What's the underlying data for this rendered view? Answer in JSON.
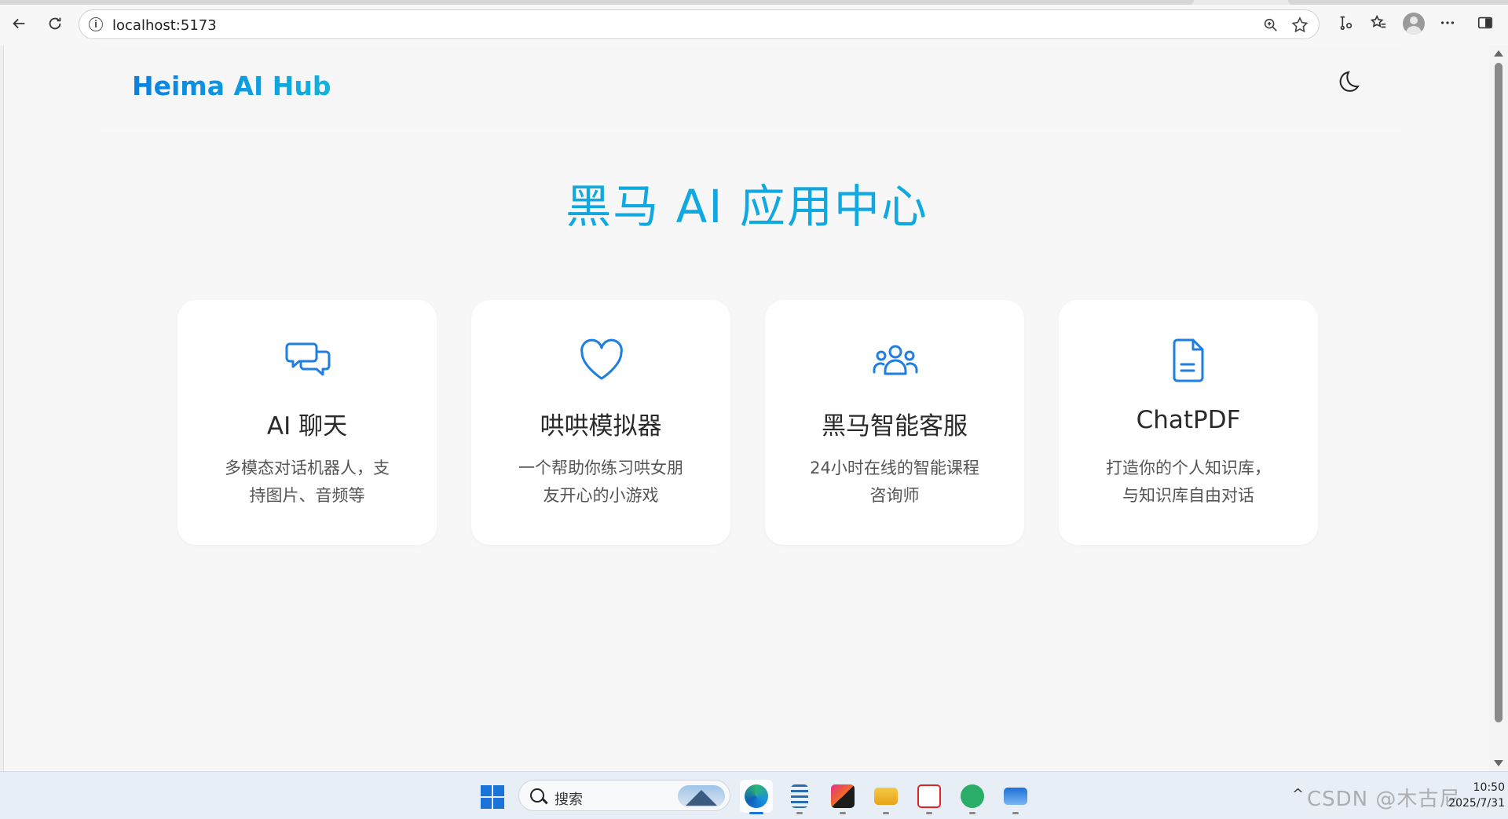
{
  "browser": {
    "url": "localhost:5173"
  },
  "app": {
    "logo": "Heima AI Hub",
    "page_title": "黑马 AI 应用中心"
  },
  "cards": [
    {
      "icon": "chat-bubbles-icon",
      "title": "AI 聊天",
      "desc": "多模态对话机器人，支持图片、音频等"
    },
    {
      "icon": "heart-icon",
      "title": "哄哄模拟器",
      "desc": "一个帮助你练习哄女朋友开心的小游戏"
    },
    {
      "icon": "group-icon",
      "title": "黑马智能客服",
      "desc": "24小时在线的智能课程咨询师"
    },
    {
      "icon": "document-icon",
      "title": "ChatPDF",
      "desc": "打造你的个人知识库，与知识库自由对话"
    }
  ],
  "colors": {
    "accent": "#1f7ee0",
    "title": "#10a8e0"
  },
  "taskbar": {
    "search_label": "搜索",
    "time": "10:50",
    "date": "2025/7/31",
    "watermark": "CSDN @木古尼"
  }
}
